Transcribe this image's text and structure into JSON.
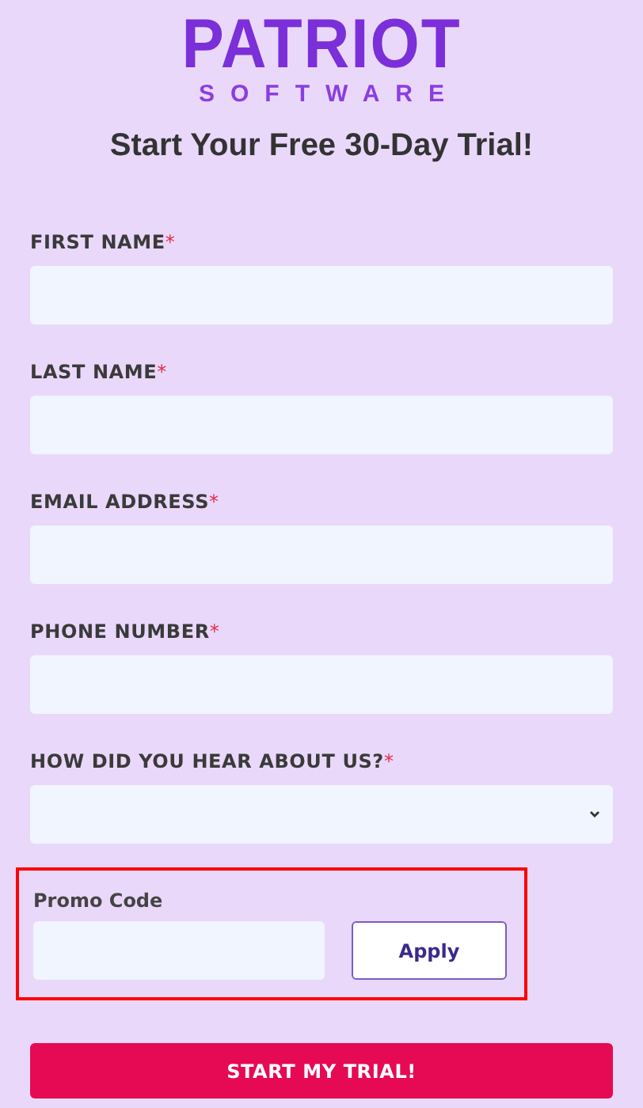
{
  "logo": {
    "wordmark": "PATRIOT",
    "subtitle": "SOFTWARE"
  },
  "title": "Start Your Free 30-Day Trial!",
  "fields": [
    {
      "kind": "text",
      "label": "FIRST NAME",
      "required_mark": "*"
    },
    {
      "kind": "text",
      "label": "LAST NAME",
      "required_mark": "*"
    },
    {
      "kind": "text",
      "label": "EMAIL ADDRESS",
      "required_mark": "*"
    },
    {
      "kind": "text",
      "label": "PHONE NUMBER",
      "required_mark": "*"
    },
    {
      "kind": "select",
      "label": "HOW DID YOU HEAR ABOUT US?",
      "required_mark": "*"
    }
  ],
  "promo": {
    "label": "Promo Code",
    "button": "Apply",
    "highlighted": true
  },
  "submit": "START MY TRIAL!"
}
